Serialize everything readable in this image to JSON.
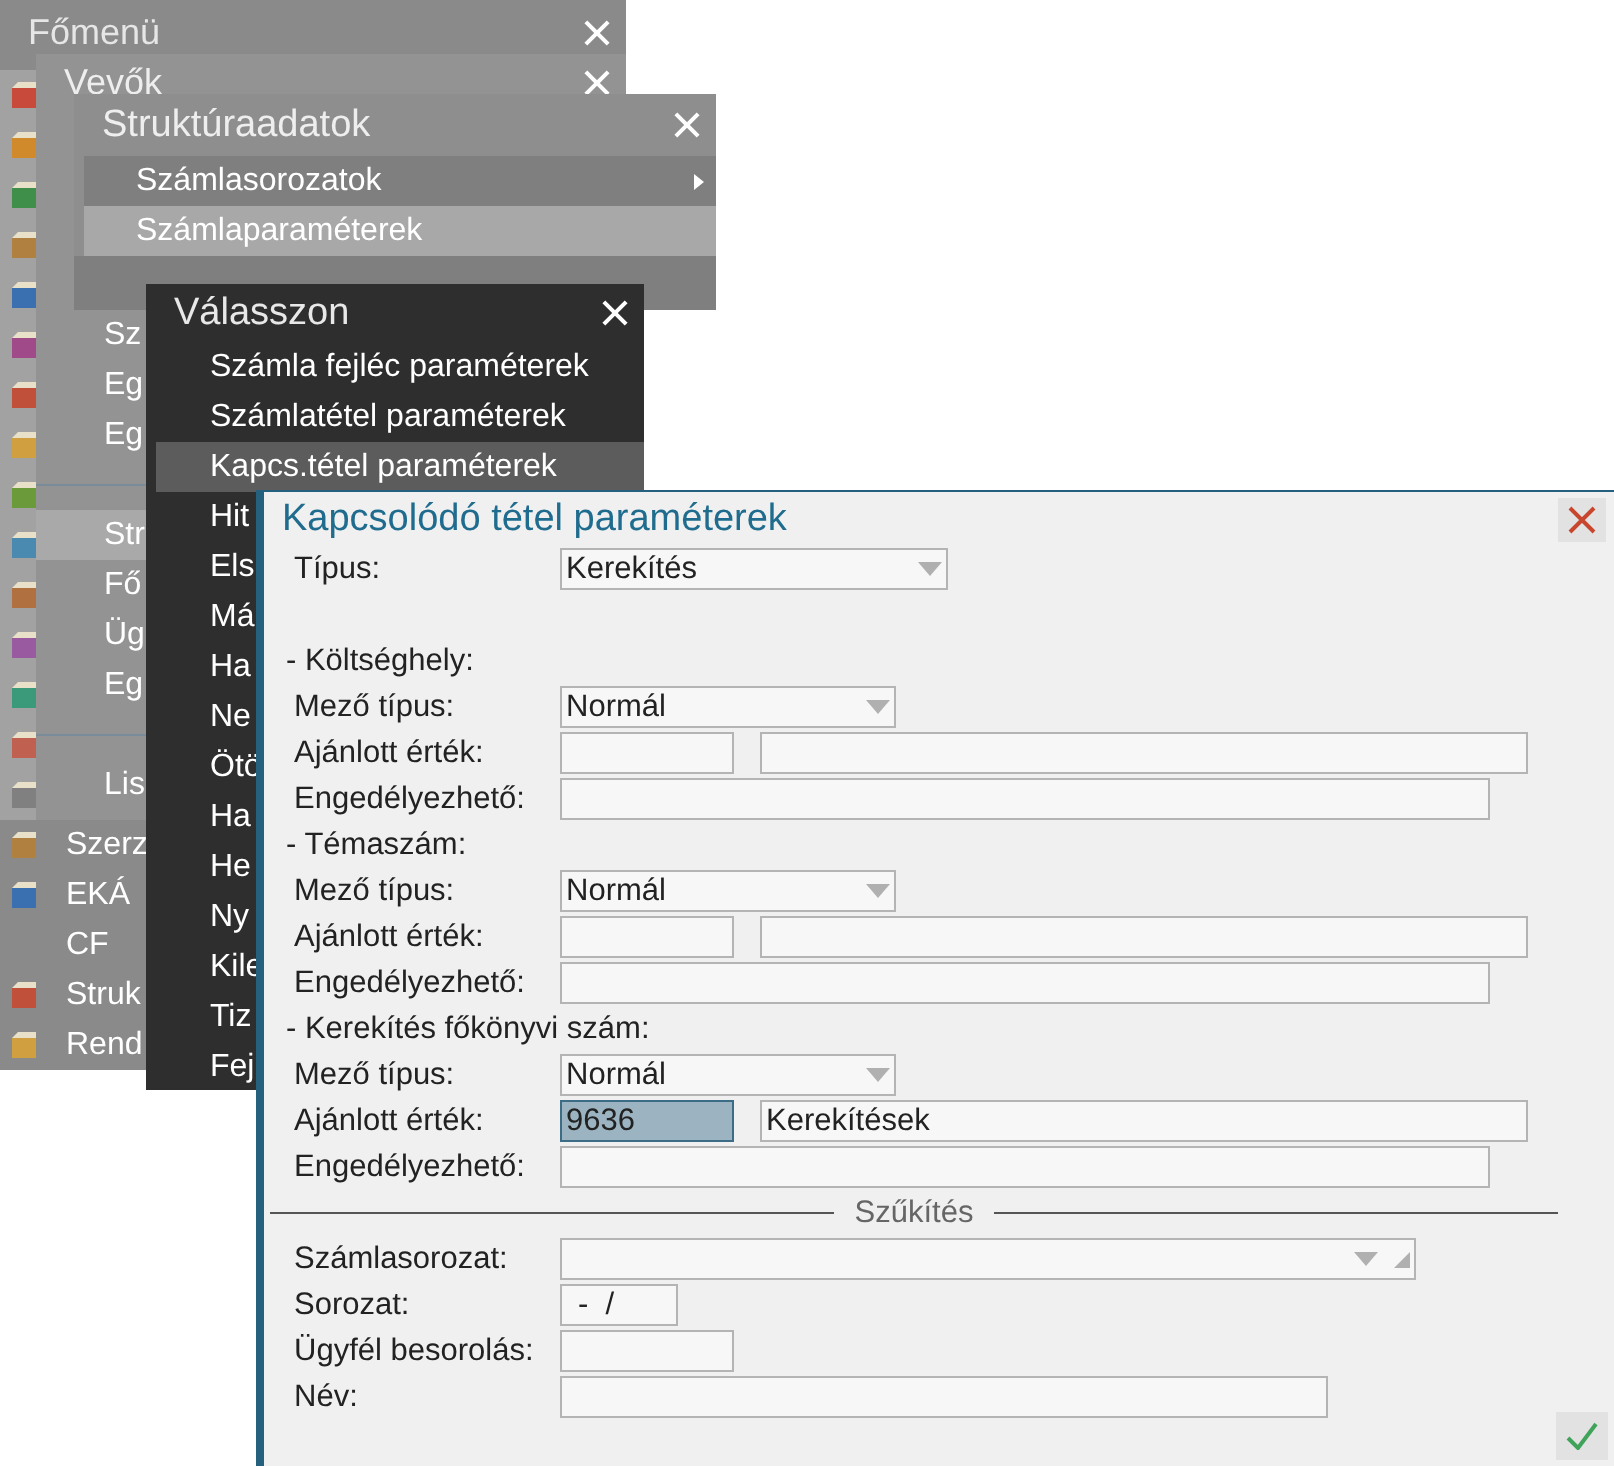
{
  "main_menu": {
    "title": "Főmenü",
    "items": [
      {
        "label": "Szerz"
      },
      {
        "label": "EKÁ"
      },
      {
        "label": "CF"
      },
      {
        "label": "Struk"
      },
      {
        "label": "Rend"
      }
    ]
  },
  "customers_menu": {
    "title": "Vevők",
    "items": [
      {
        "kind": "item",
        "label": "Sz",
        "selected": false
      },
      {
        "kind": "item",
        "label": "Eg",
        "selected": false
      },
      {
        "kind": "item",
        "label": "Eg",
        "selected": false
      },
      {
        "kind": "separator"
      },
      {
        "kind": "item",
        "label": "Str",
        "selected": true
      },
      {
        "kind": "item",
        "label": "Fő",
        "selected": false
      },
      {
        "kind": "item",
        "label": "Üg",
        "selected": false
      },
      {
        "kind": "item",
        "label": "Eg",
        "selected": false
      },
      {
        "kind": "separator"
      },
      {
        "kind": "item",
        "label": "Lis",
        "selected": false
      }
    ]
  },
  "structure_menu": {
    "title": "Struktúraadatok",
    "items": [
      {
        "label": "Számlasorozatok",
        "submenu": true,
        "selected": false
      },
      {
        "label": "Számlaparaméterek",
        "submenu": false,
        "selected": true
      }
    ]
  },
  "choose_menu": {
    "title": "Válasszon",
    "items": [
      {
        "label": "Számla fejléc paraméterek",
        "selected": false
      },
      {
        "label": "Számlatétel paraméterek",
        "selected": false
      },
      {
        "label": "Kapcs.tétel paraméterek",
        "selected": true
      },
      {
        "label": "Hit",
        "selected": false
      },
      {
        "label": "Els",
        "selected": false
      },
      {
        "label": "Má",
        "selected": false
      },
      {
        "label": "Ha",
        "selected": false
      },
      {
        "label": "Ne",
        "selected": false
      },
      {
        "label": "Ötö",
        "selected": false
      },
      {
        "label": "Ha",
        "selected": false
      },
      {
        "label": "He",
        "selected": false
      },
      {
        "label": "Ny",
        "selected": false
      },
      {
        "label": "Kile",
        "selected": false
      },
      {
        "label": "Tiz",
        "selected": false
      },
      {
        "label": "Fej",
        "selected": false
      }
    ]
  },
  "dialog": {
    "title": "Kapcsolódó tétel paraméterek",
    "type": {
      "label": "Típus:",
      "value": "Kerekítés"
    },
    "sections": [
      {
        "heading": "- Költséghely:",
        "rows": [
          {
            "kind": "select",
            "label": "Mező típus:",
            "value": "Normál"
          },
          {
            "kind": "pair",
            "label": "Ajánlott érték:",
            "code": {
              "selected": false
            }
          },
          {
            "kind": "wide",
            "label": "Engedélyezhető:"
          }
        ]
      },
      {
        "heading": "- Témaszám:",
        "rows": [
          {
            "kind": "select",
            "label": "Mező típus:",
            "value": "Normál"
          },
          {
            "kind": "pair",
            "label": "Ajánlott érték:",
            "code": {
              "selected": false
            }
          },
          {
            "kind": "wide",
            "label": "Engedélyezhető:"
          }
        ]
      },
      {
        "heading": "- Kerekítés főkönyvi szám:",
        "rows": [
          {
            "kind": "select",
            "label": "Mező típus:",
            "value": "Normál"
          },
          {
            "kind": "pair",
            "label": "Ajánlott érték:",
            "code": {
              "value": "9636",
              "selected": true
            },
            "name": "Kerekítések"
          },
          {
            "kind": "wide",
            "label": "Engedélyezhető:"
          }
        ]
      }
    ],
    "filter": {
      "title": "Szűkítés",
      "rows": [
        {
          "kind": "combo",
          "label": "Számlasorozat:"
        },
        {
          "kind": "series",
          "label": "Sorozat:",
          "value": "-  /"
        },
        {
          "kind": "short",
          "label": "Ügyfél besorolás:"
        },
        {
          "kind": "medium",
          "label": "Név:"
        }
      ]
    }
  }
}
